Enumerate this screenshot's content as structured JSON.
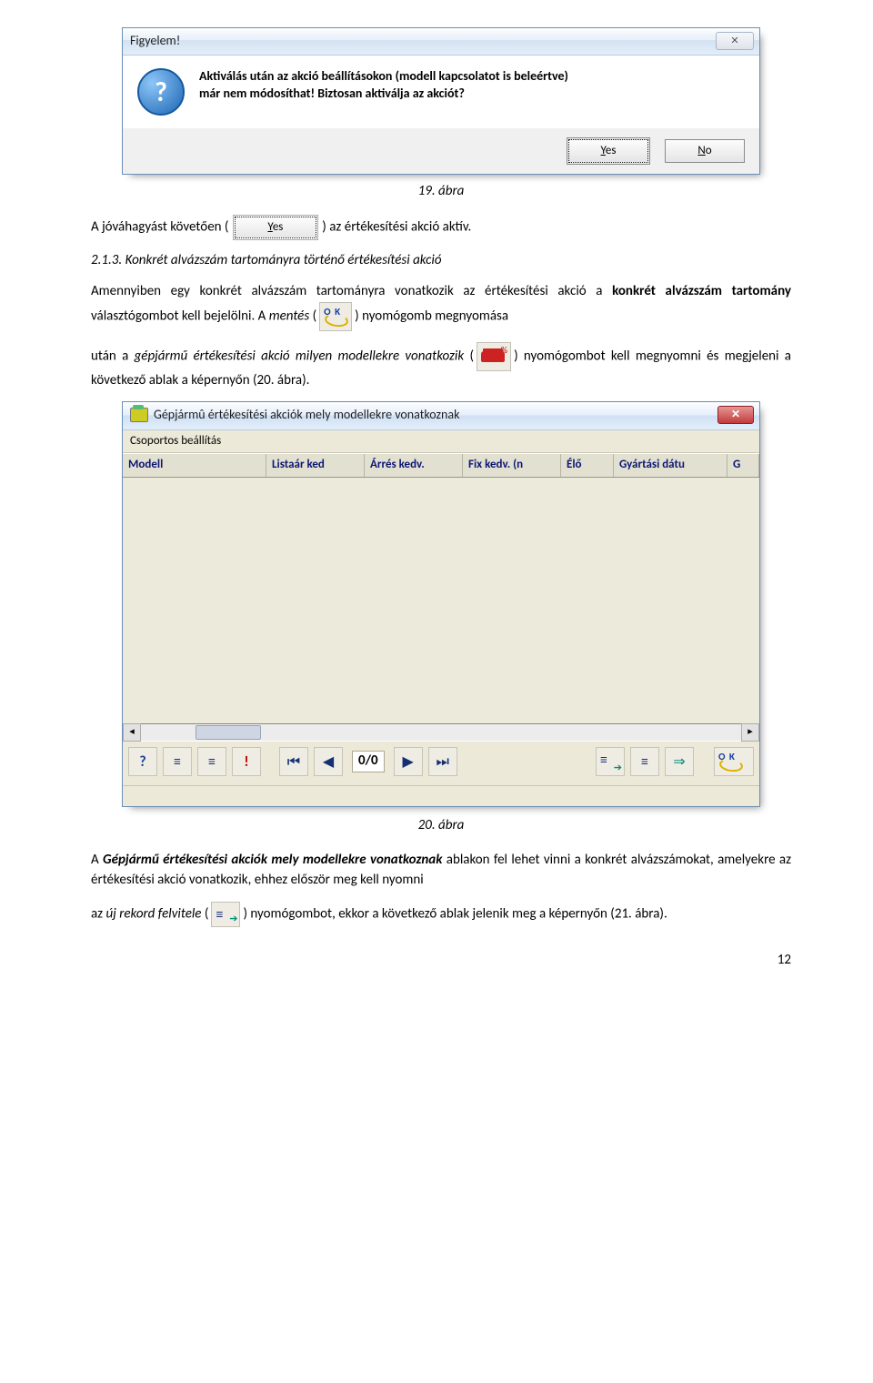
{
  "dialog1": {
    "title": "Figyelem!",
    "message_line1": "Aktiválás után az akció beállításokon (modell kapcsolatot is beleértve)",
    "message_line2": "már nem módosíthat! Biztosan aktiválja az akciót?",
    "yes": "Yes",
    "no": "No",
    "yes_underlined": "Y",
    "no_underlined": "N"
  },
  "fig19": "19. ábra",
  "para1_before": "A jóváhagyást követően (",
  "para1_after": ") az értékesítési akció aktív.",
  "yes_inline": "Yes",
  "section_no": "2.1.3. ",
  "section_title": "Konkrét alvázszám tartományra történő értékesítési akció",
  "para2": "Amennyiben egy konkrét alvázszám tartományra vonatkozik az értékesítési akció a",
  "para2_bold": " konkrét alvázszám tartomány ",
  "para2_cont": "választógombot kell bejelölni. A ",
  "mentes": "mentés",
  "para2_open": "(",
  "para2_close": ") nyomógomb megnyomása",
  "para3a": "után a ",
  "para3_it": "gépjármű értékesítési akció milyen modellekre vonatkozik",
  "para3_open": " (",
  "para3_close": ") nyomógombot kell megnyomni és megjeleni a következő ablak a képernyőn (20. ábra).",
  "datawin": {
    "title": "Gépjármû értékesítési akciók mely modellekre vonatkoznak",
    "toolbar": "Csoportos beállítás",
    "counter": "0/0",
    "cols": {
      "c1": "Modell",
      "c2": "Listaár ked",
      "c3": "Árrés kedv.",
      "c4": "Fix kedv. (n",
      "c5": "Élő",
      "c6": "Gyártási dátu",
      "c7": "G"
    }
  },
  "fig20": "20. ábra",
  "para4_pre": "A ",
  "para4_bold": "Gépjármű értékesítési akciók mely modellekre vonatkoznak",
  "para4_rest": " ablakon fel lehet vinni a konkrét alvázszámokat, amelyekre az értékesítési akció vonatkozik, ehhez először meg kell nyomni",
  "para5_pre": "az ",
  "para5_it": "új rekord felvitele",
  "para5_open": " (",
  "para5_rest": ") nyomógombot, ekkor a következő ablak jelenik meg a képernyőn (21. ábra).",
  "pagenum": "12"
}
